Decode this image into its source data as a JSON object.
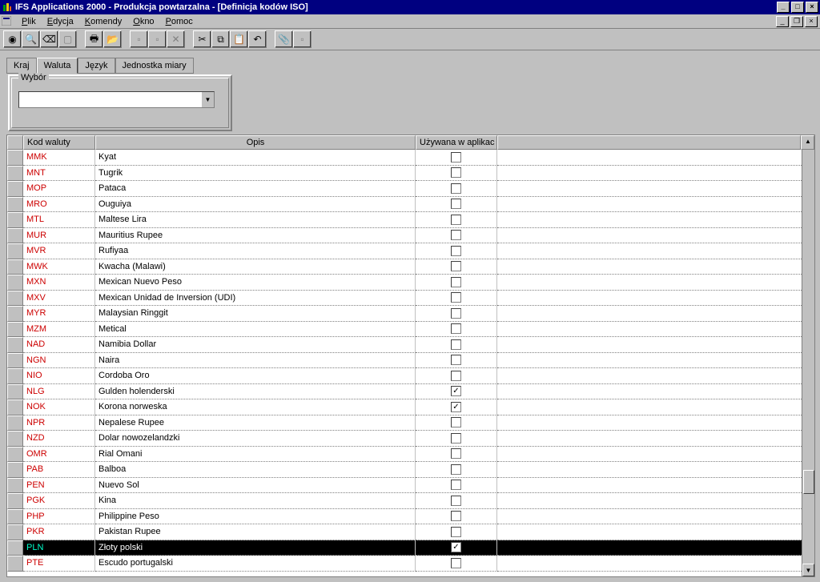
{
  "window": {
    "title": "IFS Applications 2000 - Produkcja powtarzalna - [Definicja kodów ISO]"
  },
  "menu": {
    "plik": "Plik",
    "edycja": "Edycja",
    "komendy": "Komendy",
    "okno": "Okno",
    "pomoc": "Pomoc"
  },
  "tabs": {
    "kraj": "Kraj",
    "waluta": "Waluta",
    "jezyk": "Język",
    "jednostka": "Jednostka miary"
  },
  "panel": {
    "label": "Wybór",
    "value": ""
  },
  "columns": {
    "code": "Kod waluty",
    "desc": "Opis",
    "used": "Używana w aplikac"
  },
  "rows": [
    {
      "code": "MMK",
      "desc": "Kyat",
      "used": false,
      "sel": false
    },
    {
      "code": "MNT",
      "desc": "Tugrik",
      "used": false,
      "sel": false
    },
    {
      "code": "MOP",
      "desc": "Pataca",
      "used": false,
      "sel": false
    },
    {
      "code": "MRO",
      "desc": "Ouguiya",
      "used": false,
      "sel": false
    },
    {
      "code": "MTL",
      "desc": "Maltese Lira",
      "used": false,
      "sel": false
    },
    {
      "code": "MUR",
      "desc": "Mauritius Rupee",
      "used": false,
      "sel": false
    },
    {
      "code": "MVR",
      "desc": "Rufiyaa",
      "used": false,
      "sel": false
    },
    {
      "code": "MWK",
      "desc": "Kwacha (Malawi)",
      "used": false,
      "sel": false
    },
    {
      "code": "MXN",
      "desc": "Mexican Nuevo Peso",
      "used": false,
      "sel": false
    },
    {
      "code": "MXV",
      "desc": "Mexican Unidad de Inversion (UDI)",
      "used": false,
      "sel": false
    },
    {
      "code": "MYR",
      "desc": "Malaysian Ringgit",
      "used": false,
      "sel": false
    },
    {
      "code": "MZM",
      "desc": "Metical",
      "used": false,
      "sel": false
    },
    {
      "code": "NAD",
      "desc": "Namibia Dollar",
      "used": false,
      "sel": false
    },
    {
      "code": "NGN",
      "desc": "Naira",
      "used": false,
      "sel": false
    },
    {
      "code": "NIO",
      "desc": "Cordoba Oro",
      "used": false,
      "sel": false
    },
    {
      "code": "NLG",
      "desc": "Gulden holenderski",
      "used": true,
      "sel": false
    },
    {
      "code": "NOK",
      "desc": "Korona norweska",
      "used": true,
      "sel": false
    },
    {
      "code": "NPR",
      "desc": "Nepalese Rupee",
      "used": false,
      "sel": false
    },
    {
      "code": "NZD",
      "desc": "Dolar nowozelandzki",
      "used": false,
      "sel": false
    },
    {
      "code": "OMR",
      "desc": "Rial Omani",
      "used": false,
      "sel": false
    },
    {
      "code": "PAB",
      "desc": "Balboa",
      "used": false,
      "sel": false
    },
    {
      "code": "PEN",
      "desc": "Nuevo Sol",
      "used": false,
      "sel": false
    },
    {
      "code": "PGK",
      "desc": "Kina",
      "used": false,
      "sel": false
    },
    {
      "code": "PHP",
      "desc": "Philippine Peso",
      "used": false,
      "sel": false
    },
    {
      "code": "PKR",
      "desc": "Pakistan Rupee",
      "used": false,
      "sel": false
    },
    {
      "code": "PLN",
      "desc": "Złoty polski",
      "used": true,
      "sel": true
    },
    {
      "code": "PTE",
      "desc": "Escudo portugalski",
      "used": false,
      "sel": false
    }
  ]
}
